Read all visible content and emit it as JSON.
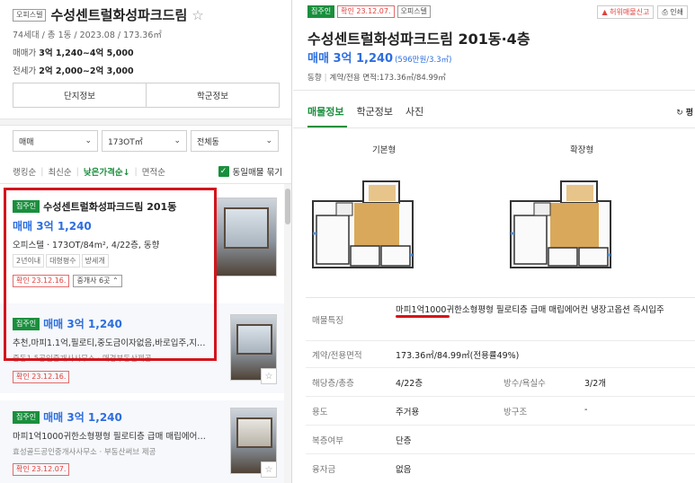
{
  "left": {
    "header": {
      "type_tag": "오피스텔",
      "title": "수성센트럴화성파크드림",
      "meta": "74세대 / 총 1동 / 2023.08 / 173.36㎡",
      "sale_label": "매매가",
      "sale_value": "3억 1,240~4억 5,000",
      "lease_label": "전세가",
      "lease_value": "2억 2,000~2억 3,000"
    },
    "tabs": [
      "단지정보",
      "학군정보"
    ],
    "filters": {
      "deal": "매매",
      "area": "173OT㎡",
      "dong": "전체동"
    },
    "sort": {
      "options": [
        "랭킹순",
        "최신순",
        "낮은가격순↓",
        "면적순"
      ],
      "active": "낮은가격순↓",
      "same_listing_label": "동일매물 묶기"
    },
    "listings": [
      {
        "badge": "집주인",
        "title": "수성센트럴화성파크드림 201동",
        "price": "매매 3억 1,240",
        "desc": "오피스텔 · 173OT/84m², 4/22층, 동향",
        "features": [
          "2년이내",
          "대형평수",
          "방세개"
        ],
        "confirm": "확인 23.12.16.",
        "brokers": "중개사 6곳"
      },
      {
        "badge": "집주인",
        "price": "매매 3억 1,240",
        "desc": "추천,마피1.1억,필로티,중도금이자없음,바로입주,지…",
        "broker": "중동1.5공인중개사사무소 · 매경부동산제공",
        "confirm": "확인 23.12.16."
      },
      {
        "badge": "집주인",
        "price": "매매 3억 1,240",
        "desc": "마피1억1000귀한소형평형 필로티층 급매 매립에어…",
        "broker": "효성골드공인중개사사무소 · 부동산써브 제공",
        "confirm": "확인 23.12.07."
      }
    ]
  },
  "right": {
    "tags": [
      "집주인",
      "확인 23.12.07.",
      "오피스텔"
    ],
    "actions": [
      "허위매물신고",
      "인쇄"
    ],
    "title": "수성센트럴화성파크드림 201동·4층",
    "price": "매매 3억 1,240",
    "price_unit": "(596만원/3.3㎡)",
    "sub_direction": "동향",
    "sub_area": "계약/전용 면적:173.36㎡/84.99㎡",
    "tabs": [
      "매물정보",
      "학군정보",
      "사진"
    ],
    "active_tab": "매물정보",
    "refresh_label": "평",
    "plan_labels": [
      "기본형",
      "확장형"
    ],
    "details": {
      "feature_label": "매물특징",
      "feature_value": "마피1억1000귀한소형평형 필로티층 급매 매립에어컨 냉장고옵션 즉시입주",
      "area_label": "계약/전용면적",
      "area_value": "173.36㎡/84.99㎡(전용률49%)",
      "floor_label": "해당층/총층",
      "floor_value": "4/22층",
      "rooms_label": "방수/욕실수",
      "rooms_value": "3/2개",
      "use_label": "용도",
      "use_value": "주거용",
      "structure_label": "방구조",
      "structure_value": "-",
      "duplex_label": "복층여부",
      "duplex_value": "단층",
      "loan_label": "융자금",
      "loan_value": "없음"
    }
  },
  "colors": {
    "accent_green": "#1a8f3d",
    "price_blue": "#2d6ee0",
    "annotation_red": "#d4141c"
  }
}
